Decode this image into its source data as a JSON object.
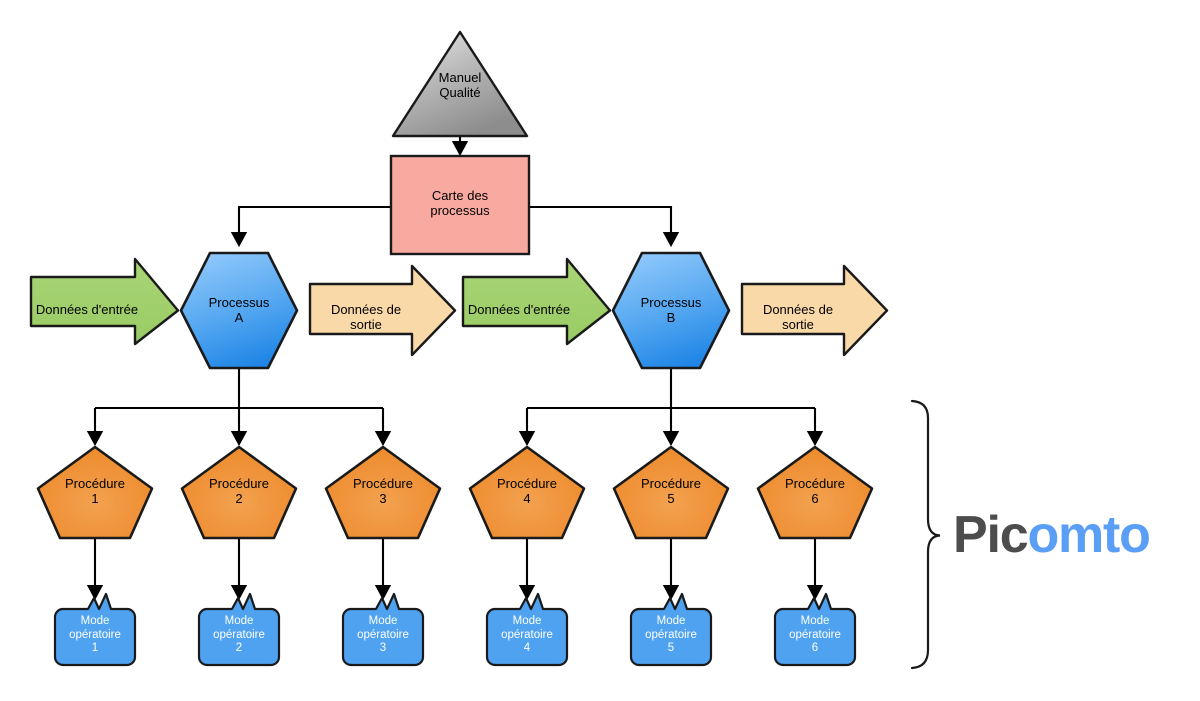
{
  "diagram": {
    "title_nodes": {
      "manual": {
        "line1": "Manuel",
        "line2": "Qualité",
        "text": "Manuel\nQualité",
        "shape": "triangle",
        "fill": "#9e9e9e"
      },
      "process_map": {
        "text": "Carte des\nprocessus",
        "shape": "rectangle",
        "fill": "#f9aaa0"
      }
    },
    "processes": [
      {
        "text": "Processus\nA",
        "shape": "hexagon",
        "fill": "#4ea2ef"
      },
      {
        "text": "Processus\nB",
        "shape": "hexagon",
        "fill": "#4ea2ef"
      }
    ],
    "input_arrows": [
      {
        "text": "Données d'entrée",
        "fill": "#a2d16b"
      },
      {
        "text": "Données d'entrée",
        "fill": "#a2d16b"
      }
    ],
    "output_arrows": [
      {
        "text": "Données de sortie",
        "fill": "#fad9a9"
      },
      {
        "text": "Données de sortie",
        "fill": "#fad9a9"
      }
    ],
    "procedures": [
      {
        "text": "Procédure\n1",
        "shape": "pentagon",
        "fill": "#f0913a"
      },
      {
        "text": "Procédure\n2",
        "shape": "pentagon",
        "fill": "#f0913a"
      },
      {
        "text": "Procédure\n3",
        "shape": "pentagon",
        "fill": "#f0913a"
      },
      {
        "text": "Procédure\n4",
        "shape": "pentagon",
        "fill": "#f0913a"
      },
      {
        "text": "Procédure\n5",
        "shape": "pentagon",
        "fill": "#f0913a"
      },
      {
        "text": "Procédure\n6",
        "shape": "pentagon",
        "fill": "#f0913a"
      }
    ],
    "work_instructions": [
      {
        "text": "Mode\nopératoire\n1",
        "shape": "callout",
        "fill": "#4ea2ef"
      },
      {
        "text": "Mode\nopératoire\n2",
        "shape": "callout",
        "fill": "#4ea2ef"
      },
      {
        "text": "Mode\nopératoire\n3",
        "shape": "callout",
        "fill": "#4ea2ef"
      },
      {
        "text": "Mode\nopératoire\n4",
        "shape": "callout",
        "fill": "#4ea2ef"
      },
      {
        "text": "Mode\nopératoire\n5",
        "shape": "callout",
        "fill": "#4ea2ef"
      },
      {
        "text": "Mode\nopératoire\n6",
        "shape": "callout",
        "fill": "#4ea2ef"
      }
    ],
    "brace": {
      "name": "curly-brace",
      "color": "#1a1a1a"
    }
  },
  "logo": {
    "part1": "Pic",
    "part2": "omto",
    "part1_color": "#4d4d4d",
    "part2_color": "#5a9ef5"
  }
}
